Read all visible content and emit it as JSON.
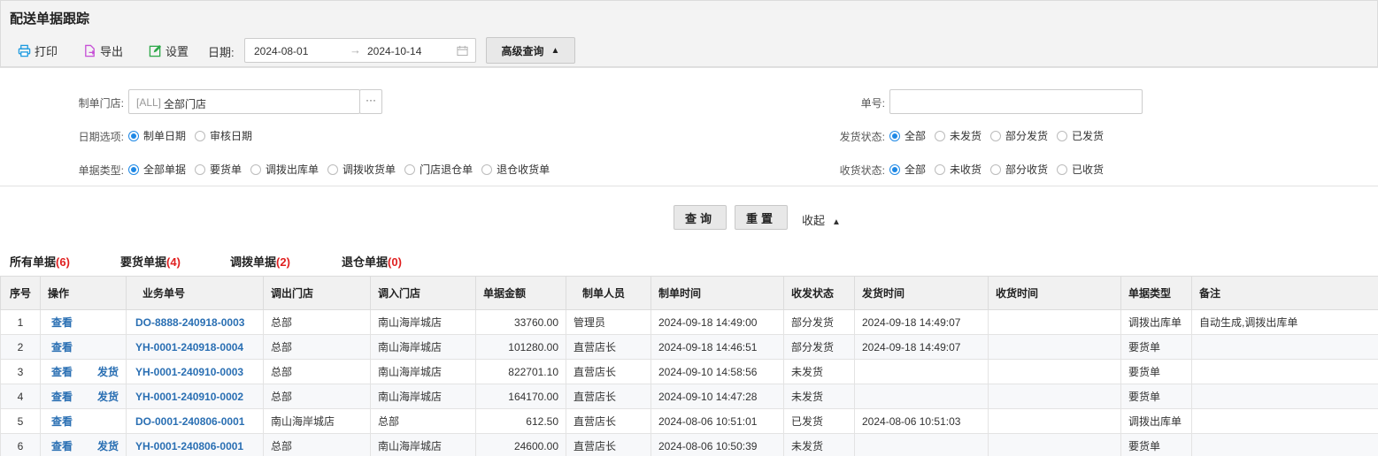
{
  "page": {
    "title": "配送单据跟踪"
  },
  "toolbar": {
    "print_label": "打印",
    "export_label": "导出",
    "settings_label": "设置",
    "date_label": "日期:",
    "date_from": "2024-08-01",
    "date_arrow": "→",
    "date_to": "2024-10-14",
    "advanced_label": "高级查询",
    "advanced_caret": "▲"
  },
  "filter": {
    "store_label": "制单门店:",
    "store_tag": "[ALL]",
    "store_value": "全部门店",
    "store_more": "···",
    "docno_label": "单号:",
    "docno_value": "",
    "date_option_label": "日期选项:",
    "date_options": [
      "制单日期",
      "审核日期"
    ],
    "ship_status_label": "发货状态:",
    "ship_status_options": [
      "全部",
      "未发货",
      "部分发货",
      "已发货"
    ],
    "doc_type_label": "单据类型:",
    "doc_type_options": [
      "全部单据",
      "要货单",
      "调拨出库单",
      "调拨收货单",
      "门店退仓单",
      "退仓收货单"
    ],
    "recv_status_label": "收货状态:",
    "recv_status_options": [
      "全部",
      "未收货",
      "部分收货",
      "已收货"
    ]
  },
  "actions": {
    "query_label": "查询",
    "reset_label": "重置",
    "collapse_label": "收起",
    "collapse_caret": "▲"
  },
  "tabs": [
    {
      "label": "所有单据",
      "count": "(6)"
    },
    {
      "label": "要货单据",
      "count": "(4)"
    },
    {
      "label": "调拨单据",
      "count": "(2)"
    },
    {
      "label": "退仓单据",
      "count": "(0)"
    }
  ],
  "table": {
    "headers": [
      "序号",
      "操作",
      "业务单号",
      "调出门店",
      "调入门店",
      "单据金额",
      "制单人员",
      "制单时间",
      "收发状态",
      "发货时间",
      "收货时间",
      "单据类型",
      "备注"
    ],
    "rows": [
      {
        "no": "1",
        "view": "查看",
        "ship": "",
        "docno": "DO-8888-240918-0003",
        "from": "总部",
        "to": "南山海岸城店",
        "amount": "33760.00",
        "maker": "管理员",
        "made": "2024-09-18 14:49:00",
        "status": "部分发货",
        "shipped": "2024-09-18 14:49:07",
        "received": "",
        "type": "调拨出库单",
        "remark": "自动生成,调拨出库单"
      },
      {
        "no": "2",
        "view": "查看",
        "ship": "",
        "docno": "YH-0001-240918-0004",
        "from": "总部",
        "to": "南山海岸城店",
        "amount": "101280.00",
        "maker": "直营店长",
        "made": "2024-09-18 14:46:51",
        "status": "部分发货",
        "shipped": "2024-09-18 14:49:07",
        "received": "",
        "type": "要货单",
        "remark": ""
      },
      {
        "no": "3",
        "view": "查看",
        "ship": "发货",
        "docno": "YH-0001-240910-0003",
        "from": "总部",
        "to": "南山海岸城店",
        "amount": "822701.10",
        "maker": "直营店长",
        "made": "2024-09-10 14:58:56",
        "status": "未发货",
        "shipped": "",
        "received": "",
        "type": "要货单",
        "remark": ""
      },
      {
        "no": "4",
        "view": "查看",
        "ship": "发货",
        "docno": "YH-0001-240910-0002",
        "from": "总部",
        "to": "南山海岸城店",
        "amount": "164170.00",
        "maker": "直营店长",
        "made": "2024-09-10 14:47:28",
        "status": "未发货",
        "shipped": "",
        "received": "",
        "type": "要货单",
        "remark": ""
      },
      {
        "no": "5",
        "view": "查看",
        "ship": "",
        "docno": "DO-0001-240806-0001",
        "from": "南山海岸城店",
        "to": "总部",
        "amount": "612.50",
        "maker": "直营店长",
        "made": "2024-08-06 10:51:01",
        "status": "已发货",
        "shipped": "2024-08-06 10:51:03",
        "received": "",
        "type": "调拨出库单",
        "remark": ""
      },
      {
        "no": "6",
        "view": "查看",
        "ship": "发货",
        "docno": "YH-0001-240806-0001",
        "from": "总部",
        "to": "南山海岸城店",
        "amount": "24600.00",
        "maker": "直营店长",
        "made": "2024-08-06 10:50:39",
        "status": "未发货",
        "shipped": "",
        "received": "",
        "type": "要货单",
        "remark": ""
      }
    ]
  },
  "colors": {
    "link": "#2a6fb3",
    "accent": "#1e88e5",
    "alert": "#e02020"
  }
}
